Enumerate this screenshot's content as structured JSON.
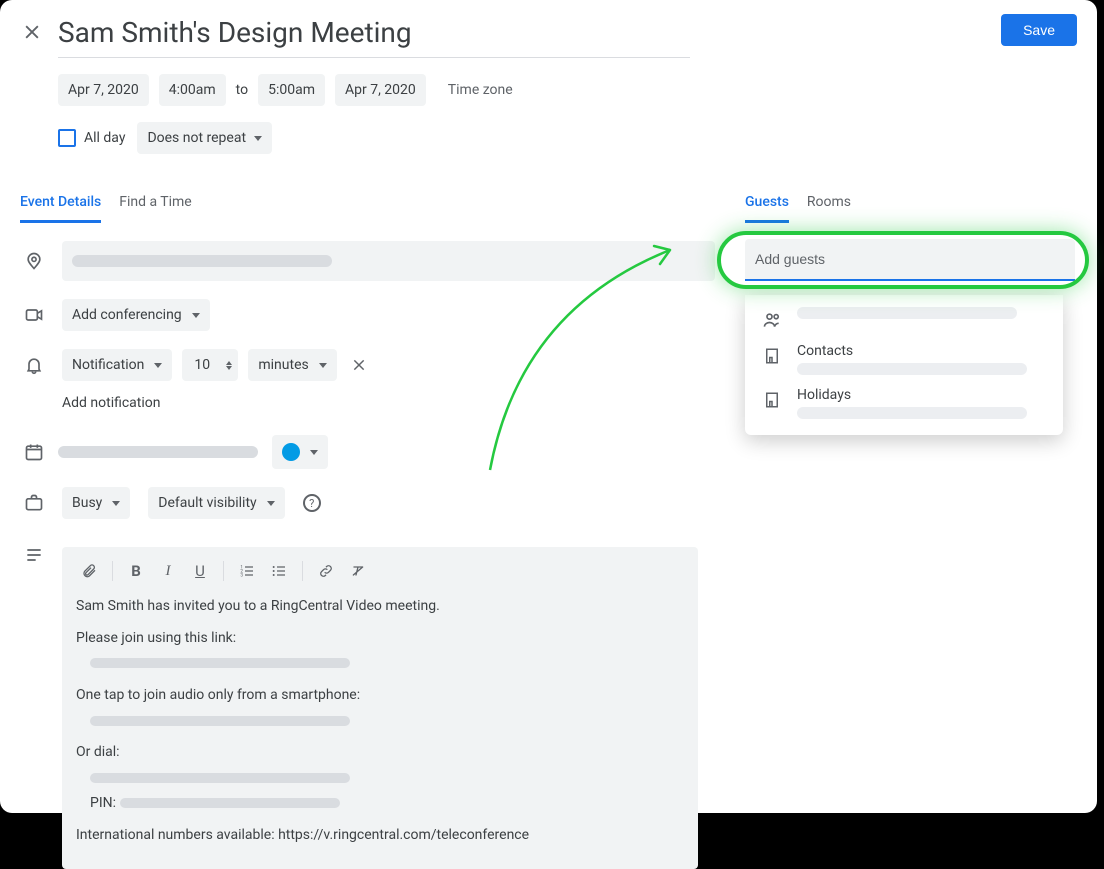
{
  "header": {
    "title": "Sam Smith's Design Meeting",
    "save_label": "Save"
  },
  "date": {
    "start_date": "Apr 7, 2020",
    "start_time": "4:00am",
    "to": "to",
    "end_time": "5:00am",
    "end_date": "Apr 7, 2020",
    "timezone": "Time zone"
  },
  "allday": {
    "label": "All day",
    "repeat": "Does not repeat"
  },
  "tabs": {
    "details": "Event Details",
    "find": "Find a Time"
  },
  "conferencing": {
    "label": "Add conferencing"
  },
  "notification": {
    "type": "Notification",
    "number": "10",
    "unit": "minutes",
    "add": "Add notification"
  },
  "availability": {
    "busy": "Busy",
    "visibility": "Default visibility"
  },
  "description": {
    "line1": "Sam Smith has invited you to a RingCentral Video meeting.",
    "line2": "Please join using this link:",
    "line3": "One tap to join audio only from a smartphone:",
    "line4": "Or dial:",
    "pin": "PIN:",
    "intl": "International numbers available: https://v.ringcentral.com/teleconference"
  },
  "right": {
    "guests_tab": "Guests",
    "rooms_tab": "Rooms",
    "placeholder": "Add guests",
    "suggest1": "Contacts",
    "suggest2": "Holidays"
  }
}
